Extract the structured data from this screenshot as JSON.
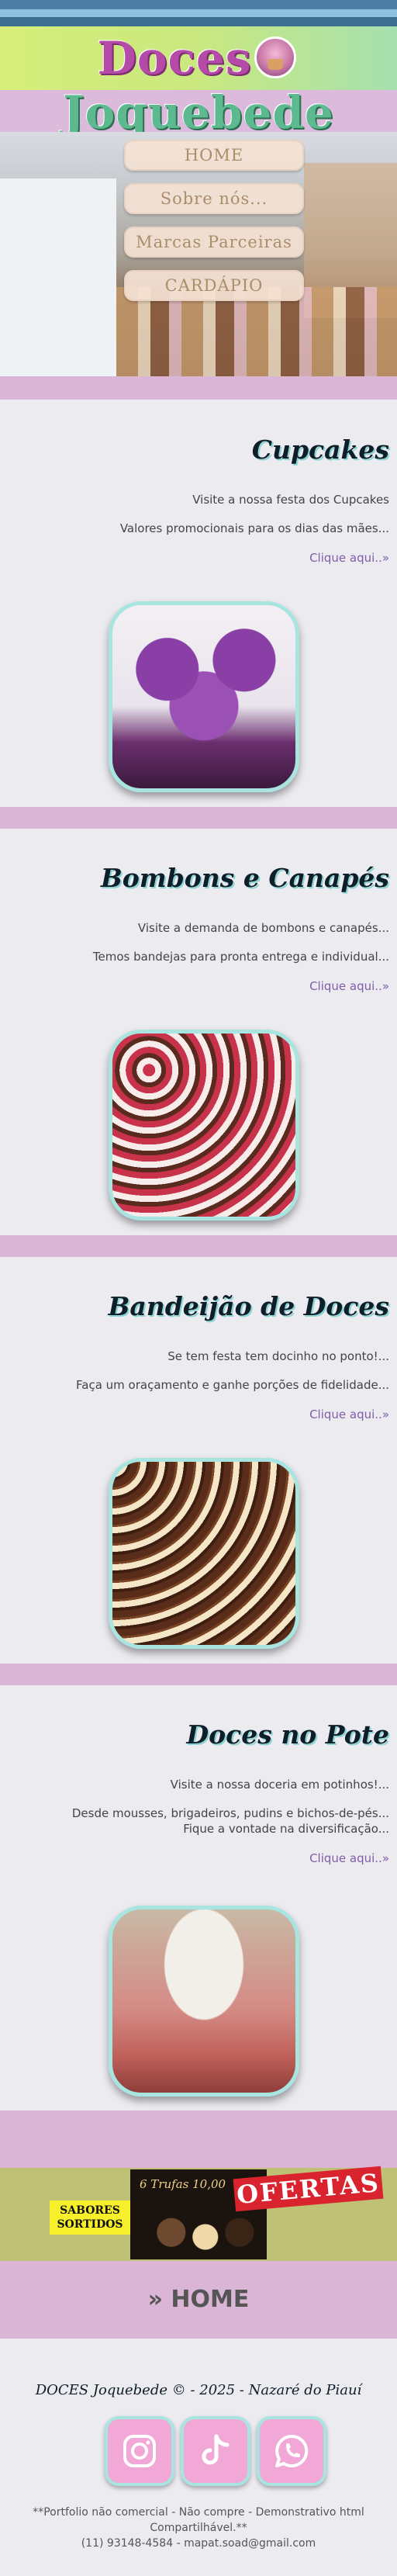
{
  "header": {
    "brand_word1": "Doces",
    "brand_word2": "Joquebede"
  },
  "nav": {
    "items": [
      {
        "label": "HOME"
      },
      {
        "label": "Sobre nós..."
      },
      {
        "label": "Marcas Parceiras"
      },
      {
        "label": "CARDÁPIO"
      }
    ]
  },
  "sections": [
    {
      "title": "Cupcakes",
      "line1": "Visite a nossa festa dos Cupcakes",
      "line2": "Valores promocionais para os dias das mães...",
      "link": "Clique aqui..»"
    },
    {
      "title": "Bombons e Canapés",
      "line1": "Visite a demanda de bombons e canapés...",
      "line2": "Temos bandejas para pronta entrega e individual...",
      "link": "Clique aqui..»"
    },
    {
      "title": "Bandeijão de Doces",
      "line1": "Se tem festa tem docinho no ponto!...",
      "line2": "Faça um oraçamento e ganhe porções de fidelidade...",
      "link": "Clique aqui..»"
    },
    {
      "title": "Doces no Pote",
      "line1": "Visite a nossa doceria em potinhos!...",
      "line2": "Desde mousses, brigadeiros, pudins e bichos-de-pés...",
      "line3": "Fique a vontade na diversificação...",
      "link": "Clique aqui..»"
    }
  ],
  "promo": {
    "sabores_line1": "SABORES",
    "sabores_line2": "SORTIDOS",
    "poster_text": "6 Trufas 10,00",
    "ofertas": "OFERTAS"
  },
  "home_link": "» HOME",
  "footer": {
    "copyright": "DOCES Joquebede © - 2025 - Nazaré do Piauí",
    "note_line1": "**Portfolio não comercial - Não compre - Demonstrativo html",
    "note_line2": "Compartilhável.**",
    "note_line3": "(11) 93148-4584 - mapat.soad@gmail.com",
    "socials": [
      {
        "icon": "instagram-icon"
      },
      {
        "icon": "tiktok-icon"
      },
      {
        "icon": "whatsapp-icon"
      }
    ]
  },
  "colors": {
    "band_pink": "#dab5d5",
    "title_teal": "#8fd4d4",
    "link_purple": "#7f5ea8"
  }
}
